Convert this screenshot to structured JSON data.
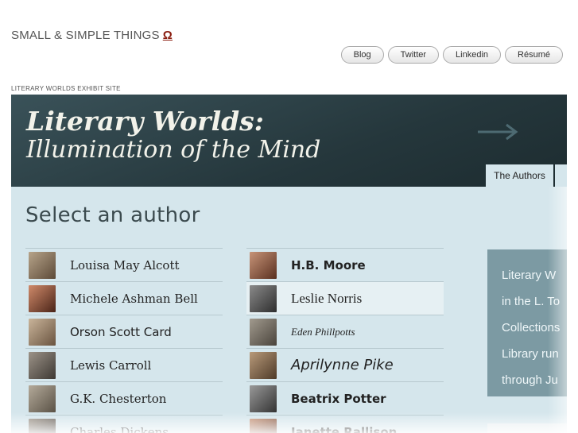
{
  "site": {
    "title": "SMALL & SIMPLE THINGS",
    "omega": "Ω"
  },
  "nav": [
    {
      "label": "Blog"
    },
    {
      "label": "Twitter"
    },
    {
      "label": "Linkedin"
    },
    {
      "label": "Résumé"
    }
  ],
  "exhibit": {
    "caption": "LITERARY WORLDS EXHIBIT SITE",
    "banner_line1": "Literary Worlds:",
    "banner_line2": "Illumination of the Mind",
    "tab_label": "The Authors",
    "heading": "Select an author",
    "left_authors": [
      {
        "name": "Louisa May Alcott"
      },
      {
        "name": "Michele Ashman Bell"
      },
      {
        "name": "Orson Scott Card"
      },
      {
        "name": "Lewis Carroll"
      },
      {
        "name": "G.K. Chesterton"
      },
      {
        "name": "Charles Dickens"
      }
    ],
    "right_authors": [
      {
        "name": "H.B. Moore"
      },
      {
        "name": "Leslie Norris"
      },
      {
        "name": "Eden Phillpotts"
      },
      {
        "name": "Aprilynne Pike"
      },
      {
        "name": "Beatrix Potter"
      },
      {
        "name": "Janette Rallison"
      }
    ],
    "side_lines": [
      "Literary W",
      "in the L. To",
      "Collections",
      "Library run",
      "through Ju"
    ]
  }
}
